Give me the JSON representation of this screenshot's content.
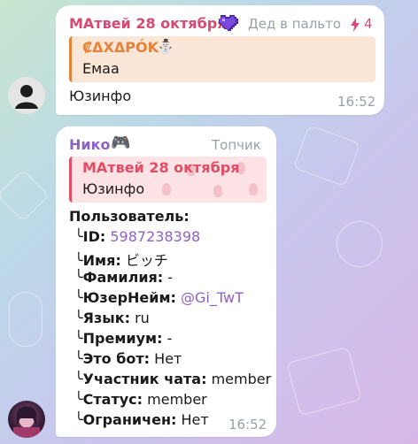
{
  "messages": [
    {
      "sender": "МАтвей 28 октября",
      "sender_title": "Дед в пальто",
      "boost_count": "4",
      "reply": {
        "name": "₡ΔΧΔΡÓΚ",
        "emoji": "⛄",
        "text": "Емаа"
      },
      "text": "Юзинфо",
      "time": "16:52"
    },
    {
      "sender": "Нико",
      "sender_emoji": "🎮",
      "sender_title": "Топчик",
      "reply": {
        "name": "МАтвей 28 октября",
        "text": "Юзинфо"
      },
      "info_header": "Пользователь:",
      "info": [
        {
          "key": "ID:",
          "value": "5987238398",
          "link": true
        },
        {
          "key": "Имя:",
          "value": "ビッチ"
        },
        {
          "key": "Фамилия:",
          "value": "-"
        },
        {
          "key": "ЮзерНейм:",
          "value": "@Gi_TwT",
          "link": true
        },
        {
          "key": "Язык:",
          "value": "ru"
        },
        {
          "key": "Премиум:",
          "value": "-"
        },
        {
          "key": "Это бот:",
          "value": "Нет"
        },
        {
          "key": "Участник чата:",
          "value": "member"
        },
        {
          "key": "Статус:",
          "value": "member"
        },
        {
          "key": "Ограничен:",
          "value": "Нет"
        }
      ],
      "time": "16:52"
    }
  ],
  "colors": {
    "sender_matvey": "#d64a73",
    "sender_niko": "#8d62c7",
    "link": "#8d62c7",
    "timestamp": "#9aa0a6"
  },
  "icons": {
    "corner_glyph": "╰",
    "boost_icon": "lightning-bolt-icon",
    "heart_icon": "purple-pixel-heart-icon"
  }
}
